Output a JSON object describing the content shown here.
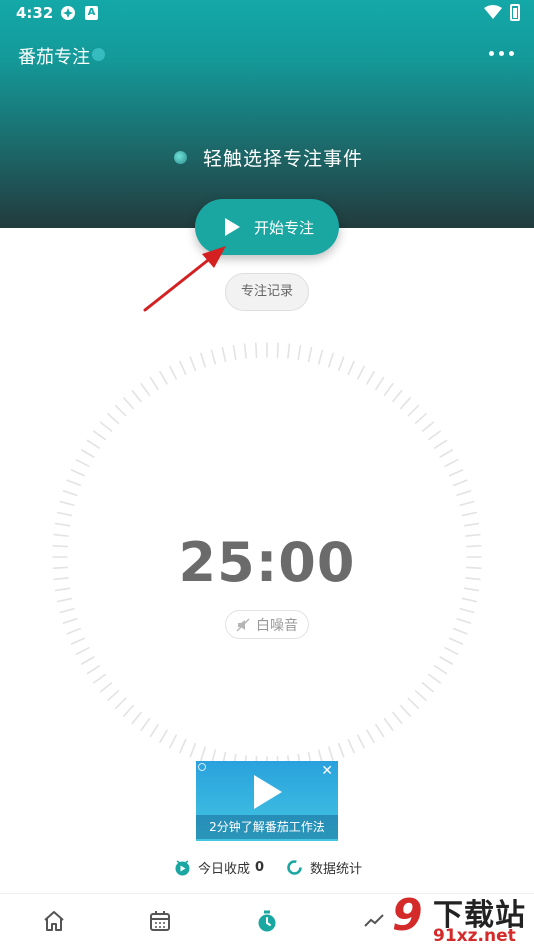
{
  "status_bar": {
    "time": "4:32",
    "app_badge": "A"
  },
  "header": {
    "title": "番茄专注"
  },
  "focus": {
    "task_prompt": "轻触选择专注事件",
    "start_label": "开始专注",
    "record_label": "专注记录",
    "timer": "25:00",
    "white_noise_label": "白噪音"
  },
  "promo": {
    "caption": "2分钟了解番茄工作法",
    "close": "✕"
  },
  "stats": {
    "today_label": "今日收成",
    "today_count": "0",
    "data_label": "数据统计"
  },
  "watermark": {
    "nine": "9",
    "big": "下载站",
    "small": "91xz.net"
  },
  "colors": {
    "accent": "#1aa7a2",
    "header_top": "#14a8a8",
    "header_bottom": "#223b3d",
    "arrow": "#d42020"
  },
  "icons": {
    "nav": [
      "home-icon",
      "calendar-icon",
      "stopwatch-icon",
      "chart-icon"
    ]
  }
}
